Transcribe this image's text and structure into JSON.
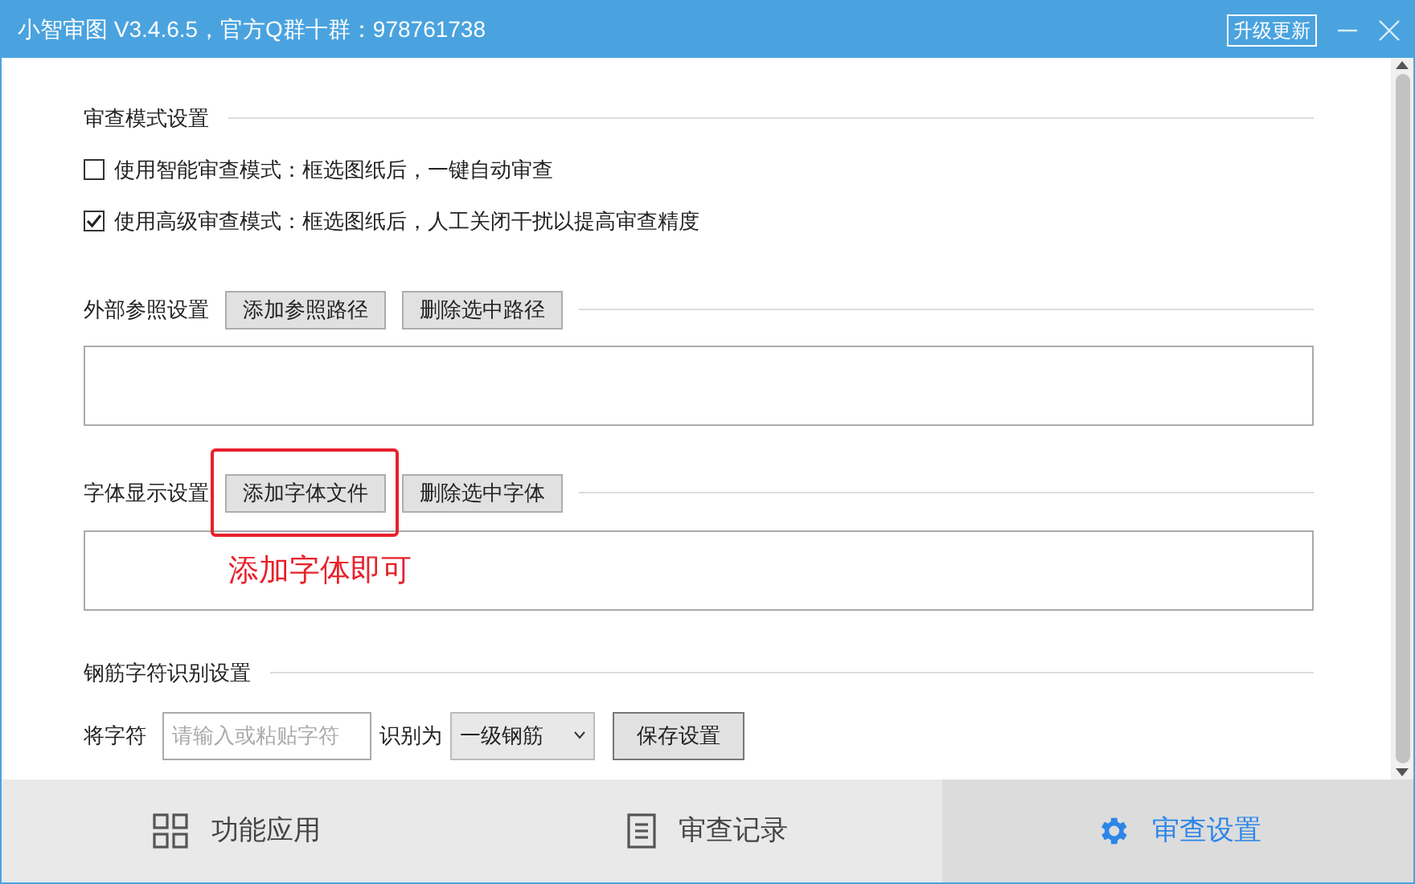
{
  "window": {
    "title": "小智审图 V3.4.6.5，官方Q群十群：978761738",
    "upgrade_button": "升级更新"
  },
  "review_mode": {
    "heading": "审查模式设置",
    "options": [
      {
        "label": "使用智能审查模式：框选图纸后，一键自动审查",
        "checked": false
      },
      {
        "label": "使用高级审查模式：框选图纸后，人工关闭干扰以提高审查精度",
        "checked": true
      }
    ]
  },
  "external_refs": {
    "heading": "外部参照设置",
    "buttons": [
      {
        "label": "添加参照路径",
        "highlighted": false
      },
      {
        "label": "删除选中路径",
        "highlighted": false
      }
    ]
  },
  "fonts": {
    "heading": "字体显示设置",
    "buttons": [
      {
        "label": "添加字体文件",
        "highlighted": true
      },
      {
        "label": "删除选中字体",
        "highlighted": false
      }
    ],
    "annotation": "添加字体即可"
  },
  "rebar": {
    "heading": "钢筋字符识别设置",
    "char_label": "将字符",
    "char_placeholder": "请输入或粘贴字符",
    "recognize_label": "识别为",
    "grade_value": "一级钢筋",
    "save_button": "保存设置"
  },
  "tabs": [
    {
      "label": "功能应用",
      "kind": "grid",
      "selected": false
    },
    {
      "label": "审查记录",
      "kind": "list",
      "selected": false
    },
    {
      "label": "审查设置",
      "kind": "gear",
      "selected": true
    }
  ]
}
